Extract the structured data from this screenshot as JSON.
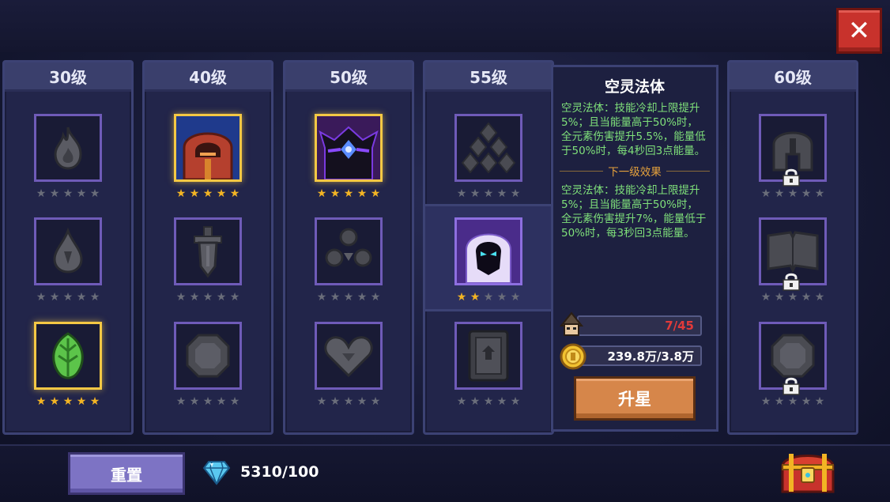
{
  "close_label": "✕",
  "tiers": [
    {
      "label": "30级"
    },
    {
      "label": "40级"
    },
    {
      "label": "50级"
    },
    {
      "label": "55级"
    },
    {
      "label": "60级"
    }
  ],
  "skills": {
    "t30": [
      {
        "icon": "flame-icon",
        "stars": 0,
        "highlight": false
      },
      {
        "icon": "droplet-icon",
        "stars": 0,
        "highlight": false
      },
      {
        "icon": "leaf-icon",
        "stars": 5,
        "highlight": true
      }
    ],
    "t40": [
      {
        "icon": "hooded-mage-icon",
        "stars": 5,
        "highlight": true
      },
      {
        "icon": "sword-icon",
        "stars": 0,
        "highlight": false
      },
      {
        "icon": "octagon-shield-icon",
        "stars": 0,
        "highlight": false
      }
    ],
    "t50": [
      {
        "icon": "dark-spirit-icon",
        "stars": 5,
        "highlight": true
      },
      {
        "icon": "clover-orbs-icon",
        "stars": 0,
        "highlight": false
      },
      {
        "icon": "heart-icon",
        "stars": 0,
        "highlight": false
      }
    ],
    "t55": [
      {
        "icon": "stacked-stones-icon",
        "stars": 0,
        "highlight": false
      },
      {
        "icon": "void-ghost-icon",
        "stars": 2,
        "highlight": true,
        "selected": true
      },
      {
        "icon": "spellbook-icon",
        "stars": 0,
        "highlight": false
      }
    ],
    "t60": [
      {
        "icon": "helmet-icon",
        "stars": 0,
        "locked": true
      },
      {
        "icon": "open-book-icon",
        "stars": 0,
        "locked": true
      },
      {
        "icon": "octagon-gem-icon",
        "stars": 0,
        "locked": true
      }
    ]
  },
  "detail": {
    "title": "空灵法体",
    "current_desc": "空灵法体：技能冷却上限提升5%；且当能量高于50%时，全元素伤害提升5.5%，能量低于50%时，每4秒回3点能量。",
    "next_label": "下一级效果",
    "next_desc": "空灵法体：技能冷却上限提升5%；且当能量高于50%时，全元素伤害提升7%，能量低于50%时，每3秒回3点能量。",
    "fragments_value": "7/45",
    "fragments_progress": 0.156,
    "coins_value": "239.8万/3.8万",
    "upgrade_label": "升星",
    "colors": {
      "current_text": "#7fe07a",
      "next_header": "#e6a23c",
      "fragments_text": "#e23a3a"
    }
  },
  "footer": {
    "reset_label": "重置",
    "gem_count": "5310/100"
  }
}
